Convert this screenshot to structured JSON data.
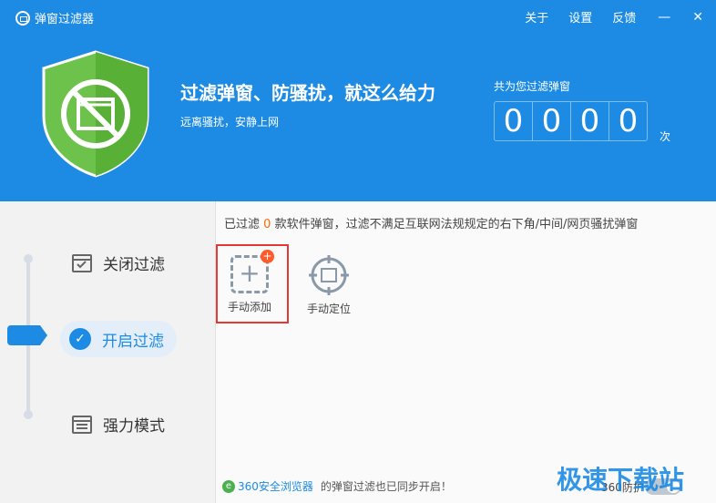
{
  "app": {
    "title": "弹窗过滤器"
  },
  "topmenu": {
    "about": "关于",
    "settings": "设置",
    "feedback": "反馈",
    "minimize": "—",
    "close": "✕"
  },
  "hero": {
    "slogan": "过滤弹窗、防骚扰，就这么给力",
    "subtitle": "远离骚扰，安静上网"
  },
  "counter": {
    "label": "共为您过滤弹窗",
    "digits": [
      "0",
      "0",
      "0",
      "0"
    ],
    "unit": "次"
  },
  "modes": {
    "close": {
      "label": "关闭过滤",
      "icon": "checkbox-window-icon"
    },
    "open": {
      "label": "开启过滤",
      "icon": "check-circle-icon",
      "active": true
    },
    "strong": {
      "label": "强力模式",
      "icon": "window-list-icon"
    }
  },
  "status": {
    "prefix": "已过滤",
    "count": "0",
    "suffix": "款软件弹窗，过滤不满足互联网法规规定的右下角/中间/网页骚扰弹窗"
  },
  "tools": {
    "manual_add": {
      "label": "手动添加",
      "icon": "dashed-add-icon",
      "badge": "+"
    },
    "manual_locate": {
      "label": "手动定位",
      "icon": "crosshair-icon"
    }
  },
  "footer": {
    "brand": "360安全浏览器",
    "message": "的弹窗过滤也已同步开启！",
    "protect_label": "360防护"
  },
  "watermark": "极速下载站",
  "colors": {
    "primary": "#1d8be3",
    "accent": "#ff6a00",
    "highlight": "#e53935",
    "shield": "#6cc24a"
  }
}
